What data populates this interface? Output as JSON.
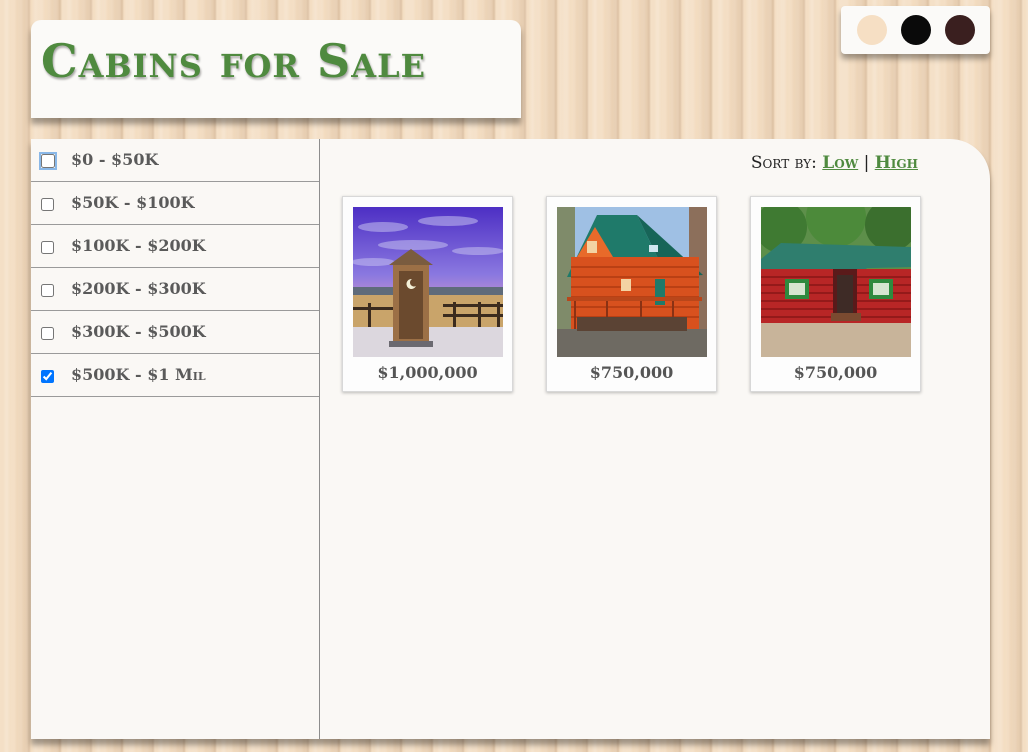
{
  "header": {
    "title": "Cabins for Sale"
  },
  "theme_swatches": [
    {
      "name": "cream",
      "color": "#f6dfc4"
    },
    {
      "name": "black",
      "color": "#0a0a0a"
    },
    {
      "name": "brown",
      "color": "#3a1f1f"
    }
  ],
  "filters": [
    {
      "label": "$0 - $50K",
      "checked": false
    },
    {
      "label": "$50K - $100K",
      "checked": false
    },
    {
      "label": "$100K - $200K",
      "checked": false
    },
    {
      "label": "$200K - $300K",
      "checked": false
    },
    {
      "label": "$300K - $500K",
      "checked": false
    },
    {
      "label": "$500K - $1 Mil",
      "checked": true
    }
  ],
  "sort": {
    "label": "Sort by:",
    "low": "Low",
    "separator": "|",
    "high": "High"
  },
  "listings": [
    {
      "price": "$1,000,000",
      "image": "outhouse-photo"
    },
    {
      "price": "$750,000",
      "image": "orange-log-cabin-photo"
    },
    {
      "price": "$750,000",
      "image": "red-log-cabin-photo"
    }
  ],
  "colors": {
    "accent": "#4f8a3f",
    "panel": "#faf8f5"
  }
}
